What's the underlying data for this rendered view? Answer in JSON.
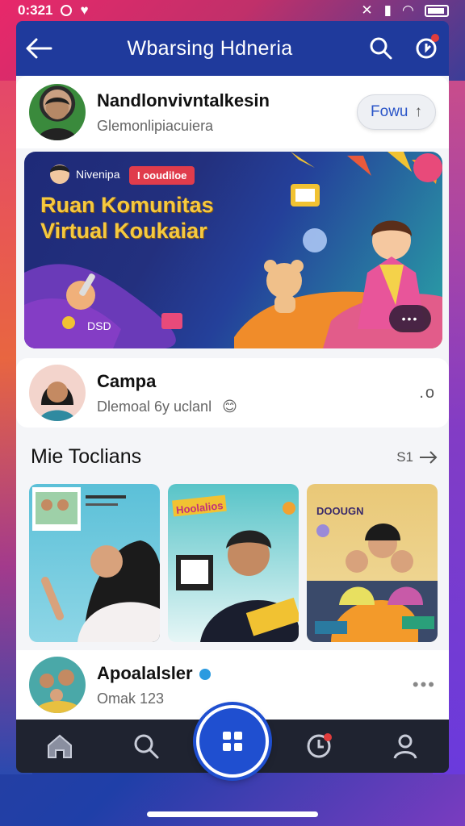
{
  "status": {
    "time": "0:321"
  },
  "header": {
    "title": "Wbarsing Hdneria"
  },
  "profile": {
    "name": "Nandlonvivntalkesin",
    "subtitle": "Glemonlipiacuiera",
    "follow_label": "Fowu"
  },
  "banner": {
    "title_line1": "Ruan Komunitas",
    "title_line2": "Virtual Koukaiar",
    "host_name": "Nivenipa",
    "badge": "I ooudiloe",
    "count": "DSD",
    "more": "•••"
  },
  "user2": {
    "name": "Campa",
    "subtitle": "Dlemoal 6y uclanl",
    "emoji": "😊",
    "action": ".o"
  },
  "section": {
    "title": "Mie Toclians",
    "see_more": "S1"
  },
  "thumbs": [
    {
      "caption": "Hoolalios"
    },
    {
      "caption": "DOOUGN"
    }
  ],
  "user3": {
    "name": "Apoalalsler",
    "subtitle": "Omak 123"
  },
  "nav": {
    "items": [
      "home-icon",
      "search-icon",
      "grid-icon",
      "clock-icon",
      "profile-icon"
    ]
  },
  "colors": {
    "accent": "#1f4fd0",
    "header": "#1f3a9c",
    "nav": "#1f2330"
  }
}
